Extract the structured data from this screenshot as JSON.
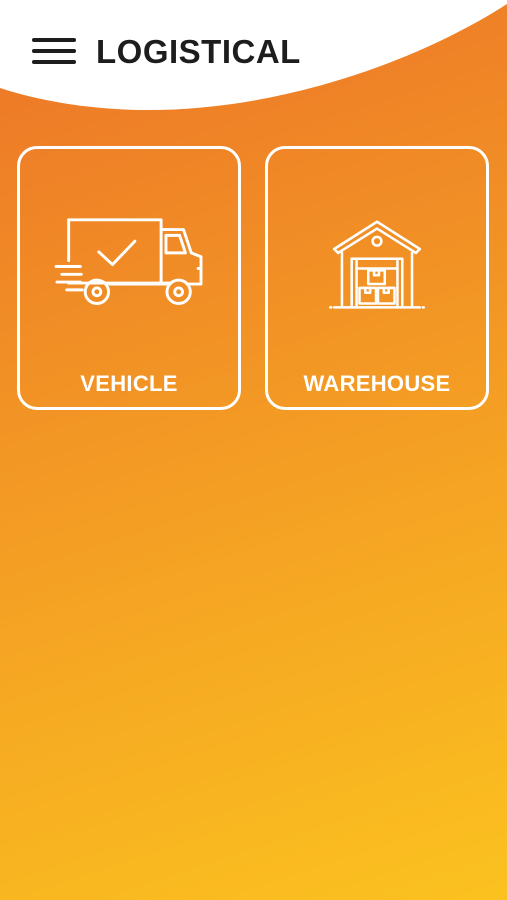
{
  "app": {
    "brand": "LOGISTICAL",
    "menu_icon": "hamburger-menu-icon"
  },
  "tiles": [
    {
      "id": "vehicle",
      "label": "VEHICLE",
      "icon": "delivery-truck-icon"
    },
    {
      "id": "warehouse",
      "label": "WAREHOUSE",
      "icon": "warehouse-icon"
    }
  ],
  "colors": {
    "gradient_top": "#ED7428",
    "gradient_bottom": "#FBC21F",
    "header_bg": "#FFFFFF",
    "text_dark": "#1D1D1D",
    "tile_stroke": "#FFFFFF"
  }
}
